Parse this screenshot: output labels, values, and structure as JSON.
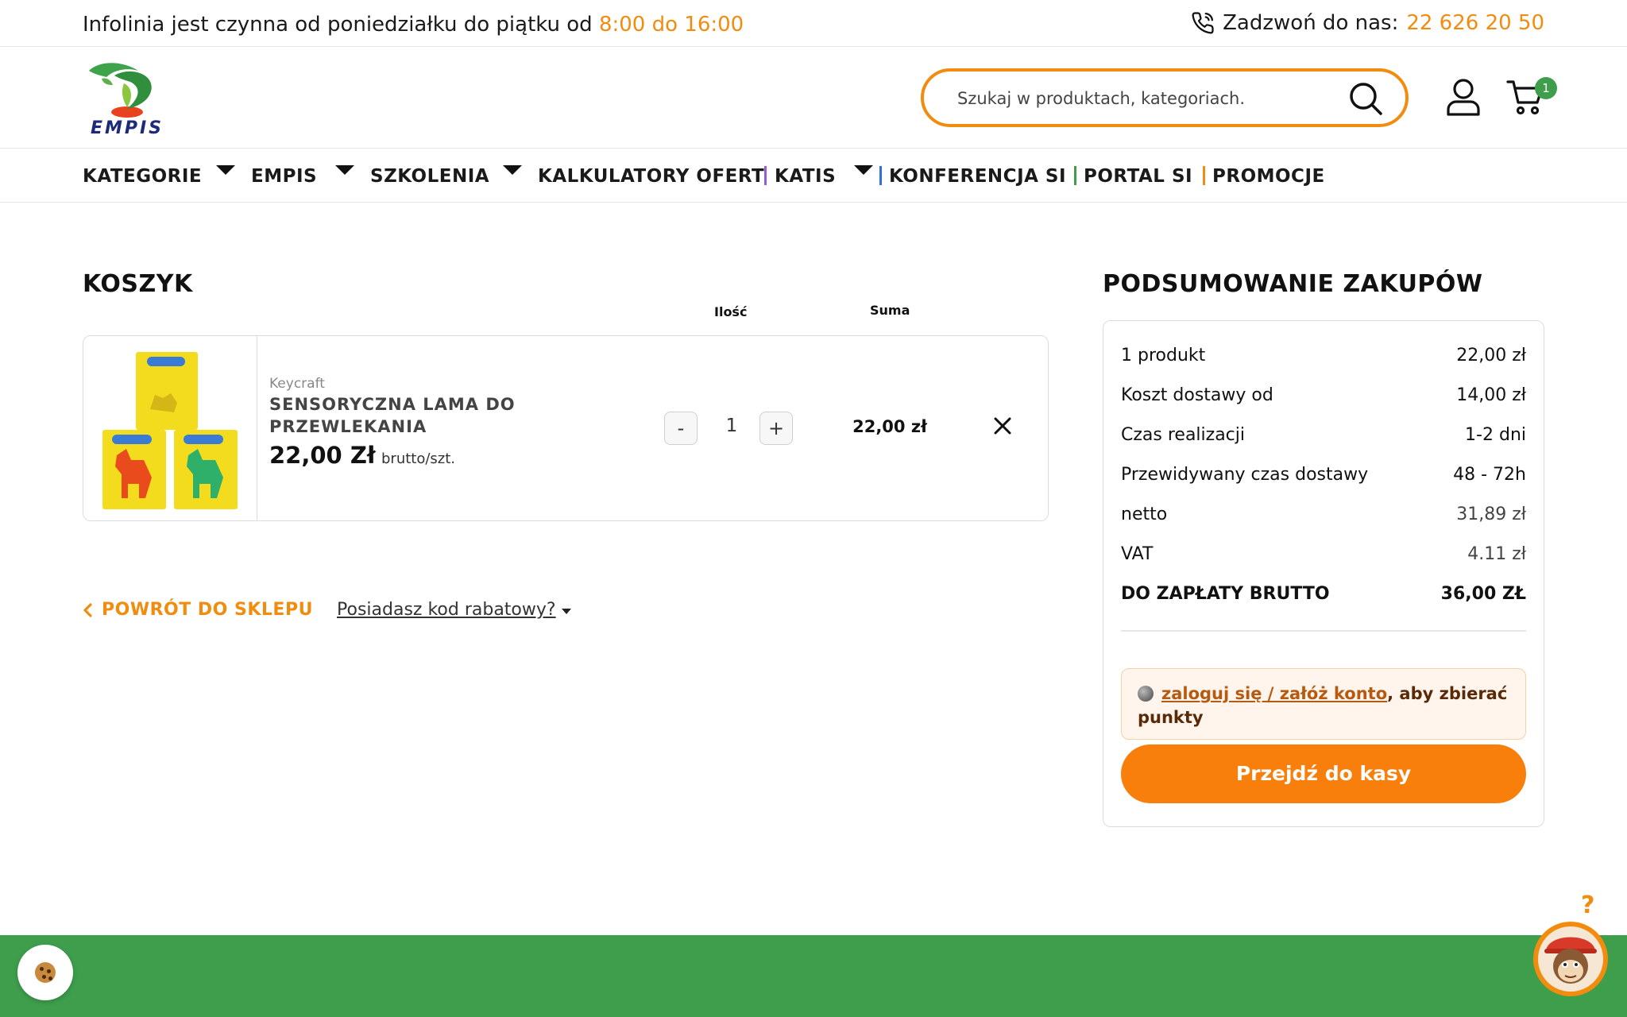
{
  "topbar": {
    "info_text": "Infolinia jest czynna od poniedziałku do piątku od ",
    "info_hours": "8:00 do 16:00",
    "call_label": "Zadzwoń do nas: ",
    "phone_number": "22 626 20 50"
  },
  "header": {
    "logo_text": "EMPIS",
    "search_placeholder": "Szukaj w produktach, kategoriach.",
    "cart_count": "1"
  },
  "nav": {
    "items": [
      "KATEGORIE",
      "EMPIS",
      "SZKOLENIA",
      "KALKULATORY OFERT",
      "KATIS",
      "KONFERENCJA SI",
      "PORTAL SI",
      "PROMOCJE"
    ]
  },
  "cart": {
    "title": "KOSZYK",
    "col_qty": "Ilość",
    "col_sum": "Suma",
    "items": [
      {
        "brand": "Keycraft",
        "name": "SENSORYCZNA LAMA DO PRZEWLEKANIA",
        "price": "22,00 Zł",
        "unit": "brutto/szt.",
        "quantity": "1",
        "minus": "-",
        "plus": "+",
        "sum": "22,00 zł"
      }
    ],
    "back_label": "POWRÓT DO SKLEPU",
    "coupon_label": "Posiadasz kod rabatowy?"
  },
  "summary": {
    "title": "PODSUMOWANIE ZAKUPÓW",
    "lines": [
      {
        "label": "1 produkt",
        "value": "22,00 zł"
      },
      {
        "label": "Koszt dostawy od",
        "value": "14,00 zł"
      },
      {
        "label": "Czas realizacji",
        "value": "1-2 dni"
      },
      {
        "label": "Przewidywany czas dostawy",
        "value": "48 - 72h"
      },
      {
        "label": "netto",
        "value": "31,89 zł"
      },
      {
        "label": "VAT",
        "value": "4.11 zł"
      },
      {
        "label": "DO ZAPŁATY BRUTTO",
        "value": "36,00 ZŁ"
      }
    ],
    "points_link": "zaloguj się / załóż konto",
    "points_text": ", aby zbierać punkty",
    "checkout_label": "Przejdź do kasy"
  },
  "help": {
    "question_mark": "?"
  },
  "colors": {
    "accent_orange": "#f28c0f",
    "checkout_orange": "#f97f0c",
    "footer_green": "#3e9e4c",
    "nav_bar_purple": "#9b59d0",
    "nav_bar_blue": "#2f6fe0",
    "nav_bar_green": "#3e9e4c",
    "nav_bar_orange": "#f28c0f"
  },
  "icons": [
    "phone-icon",
    "search-icon",
    "user-icon",
    "cart-icon",
    "chevron-left-icon",
    "close-icon",
    "cookie-icon",
    "mascot-icon"
  ]
}
